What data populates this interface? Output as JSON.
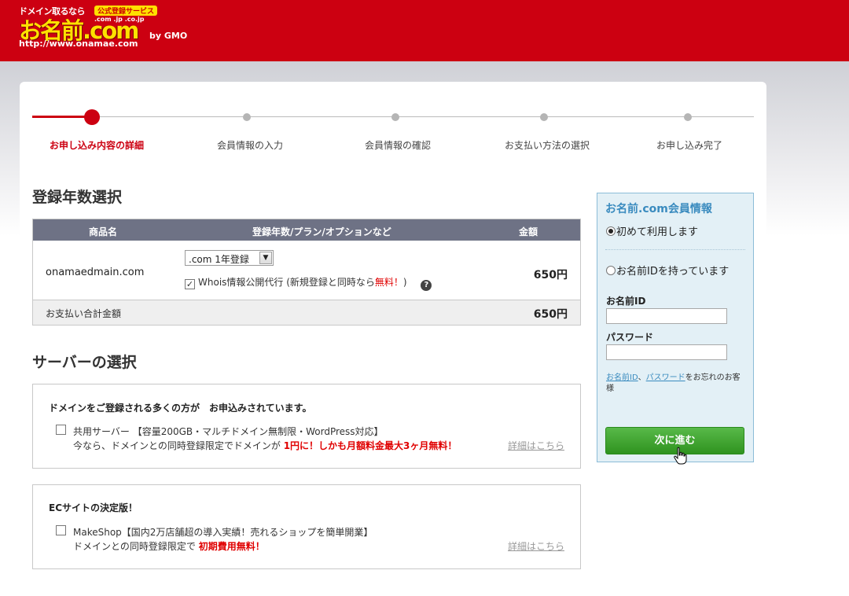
{
  "header": {
    "logo_top": "ドメイン取るなら",
    "logo_badge": "公式登録サービス",
    "logo_tlds": ".com .jp .co.jp",
    "logo_main": "お名前.com",
    "logo_by": "by GMO",
    "logo_url": "http://www.onamae.com",
    "bg_color": "#cc0011"
  },
  "steps": [
    {
      "label": "お申し込み内容の詳細",
      "active": true
    },
    {
      "label": "会員情報の入力",
      "active": false
    },
    {
      "label": "会員情報の確認",
      "active": false
    },
    {
      "label": "お支払い方法の選択",
      "active": false
    },
    {
      "label": "お申し込み完了",
      "active": false
    }
  ],
  "domain_section": {
    "title": "登録年数選択",
    "columns": [
      "商品名",
      "登録年数/プラン/オプションなど",
      "金額"
    ],
    "row": {
      "name": "onamaedmain.com",
      "plan_selected": ".com 1年登録",
      "whois_label": "Whois情報公開代行 (新規登録と同時なら",
      "whois_free": "無料！",
      "whois_close": ")",
      "whois_checked": true,
      "price": "650円"
    },
    "total_label": "お支払い合計金額",
    "total_price": "650円"
  },
  "server_section": {
    "title": "サーバーの選択",
    "boxes": [
      {
        "title": "ドメインをご登録される多くの方が　お申込みされています。",
        "line1": "共用サーバー 【容量200GB・マルチドメイン無制限・WordPress対応】",
        "line2_prefix": "今なら、ドメインとの同時登録限定でドメインが ",
        "line2_highlight": "1円に！しかも月額料金最大3ヶ月無料！",
        "link": "詳細はこちら"
      },
      {
        "title": "ECサイトの決定版！",
        "line1": "MakeShop【国内2万店舗超の導入実績！売れるショップを簡単開業】",
        "line2_prefix": "ドメインとの同時登録限定で ",
        "line2_highlight": "初期費用無料！",
        "link": "詳細はこちら"
      }
    ]
  },
  "sidebar": {
    "title": "お名前.com会員情報",
    "option_new": "初めて利用します",
    "option_existing": "お名前IDを持っています",
    "id_label": "お名前ID",
    "password_label": "パスワード",
    "forgot_id": "お名前ID",
    "forgot_sep": "、",
    "forgot_password": "パスワード",
    "forgot_suffix": "をお忘れのお客様",
    "next_button": "次に進む"
  }
}
